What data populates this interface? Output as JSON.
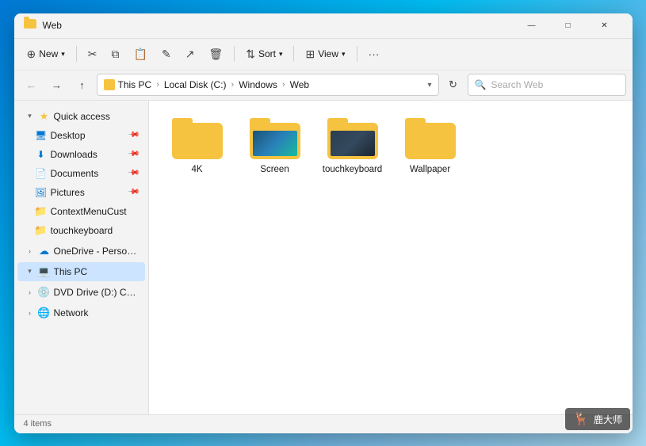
{
  "window": {
    "title": "Web",
    "controls": {
      "minimize": "—",
      "maximize": "□",
      "close": "✕"
    }
  },
  "toolbar": {
    "new_label": "New",
    "cut_tooltip": "Cut",
    "copy_tooltip": "Copy",
    "paste_tooltip": "Paste",
    "rename_tooltip": "Rename",
    "share_tooltip": "Share",
    "delete_tooltip": "Delete",
    "sort_label": "Sort",
    "view_label": "View",
    "more_tooltip": "More options"
  },
  "address_bar": {
    "this_pc": "This PC",
    "local_disk": "Local Disk (C:)",
    "windows": "Windows",
    "web": "Web",
    "search_placeholder": "Search Web"
  },
  "sidebar": {
    "quick_access_label": "Quick access",
    "items": [
      {
        "id": "desktop",
        "label": "Desktop",
        "icon": "desktop",
        "pinned": true,
        "indent": 2
      },
      {
        "id": "downloads",
        "label": "Downloads",
        "icon": "downloads",
        "pinned": true,
        "indent": 2
      },
      {
        "id": "documents",
        "label": "Documents",
        "icon": "documents",
        "pinned": true,
        "indent": 2
      },
      {
        "id": "pictures",
        "label": "Pictures",
        "icon": "pictures",
        "pinned": true,
        "indent": 2
      },
      {
        "id": "contextmenucust",
        "label": "ContextMenuCust",
        "icon": "folder",
        "indent": 2
      },
      {
        "id": "touchkeyboard",
        "label": "touchkeyboard",
        "icon": "folder",
        "indent": 2
      }
    ],
    "onedrive_label": "OneDrive - Personal",
    "this_pc_label": "This PC",
    "dvd_label": "DVD Drive (D:) CCCC",
    "network_label": "Network"
  },
  "files": [
    {
      "id": "4k",
      "label": "4K",
      "type": "plain_folder"
    },
    {
      "id": "screen",
      "label": "Screen",
      "type": "preview_screen"
    },
    {
      "id": "touchkeyboard",
      "label": "touchkeyboard",
      "type": "preview_dark"
    },
    {
      "id": "wallpaper",
      "label": "Wallpaper",
      "type": "plain_folder"
    }
  ],
  "status_bar": {
    "item_count": "4 items"
  },
  "watermark": {
    "logo": "🦌",
    "text": "鹿大师"
  }
}
